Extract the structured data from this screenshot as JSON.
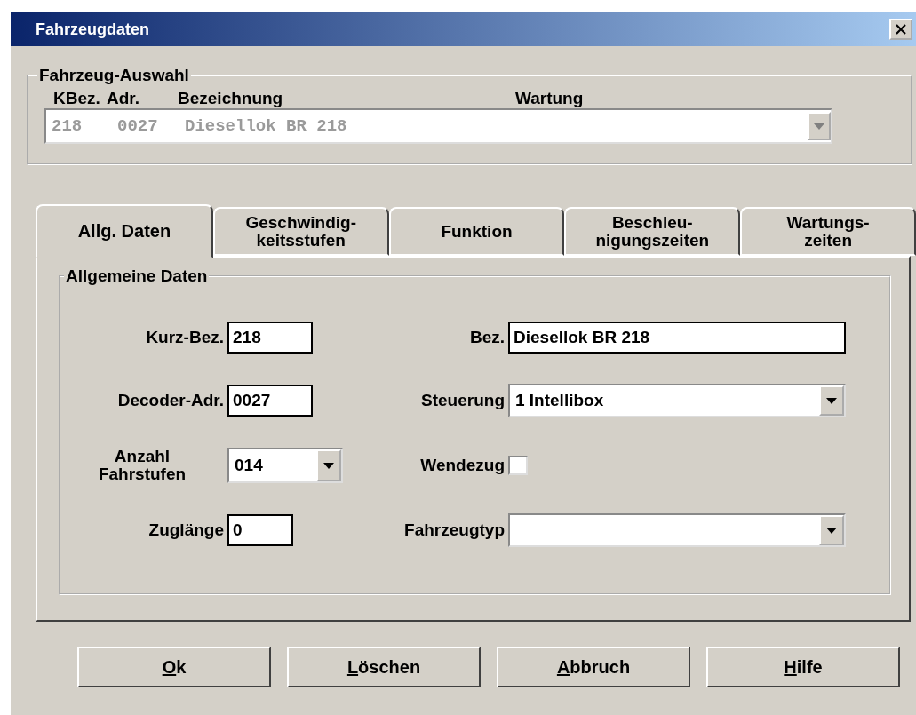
{
  "window": {
    "title": "Fahrzeugdaten"
  },
  "vehicle_selection": {
    "title": "Fahrzeug-Auswahl",
    "columns": [
      "KBez.",
      "Adr.",
      "Bezeichnung",
      "Wartung"
    ],
    "disabled": true,
    "value": [
      "218",
      "0027",
      "Diesellok BR 218"
    ]
  },
  "tabs": [
    {
      "label": "Allg. Daten",
      "selected": true
    },
    {
      "label": "Geschwindig-\nkeitsstufen",
      "selected": false
    },
    {
      "label": "Funktion",
      "selected": false
    },
    {
      "label": "Beschleu-\nnigungszeiten",
      "selected": false
    },
    {
      "label": "Wartungs-\nzeiten",
      "selected": false
    }
  ],
  "general": {
    "title": "Allgemeine Daten",
    "left": [
      {
        "kind": "text",
        "label": "Kurz-Bez.",
        "value": "218"
      },
      {
        "kind": "text",
        "label": "Decoder-Adr.",
        "value": "0027"
      },
      {
        "kind": "combo",
        "label": "Anzahl\nFahrstufen",
        "value": "014"
      },
      {
        "kind": "text",
        "label": "Zuglänge",
        "value": "0"
      }
    ],
    "right": [
      {
        "kind": "text",
        "label": "Bez.",
        "value": "Diesellok BR 218"
      },
      {
        "kind": "combo",
        "label": "Steuerung",
        "value": "1 Intellibox"
      },
      {
        "kind": "check",
        "label": "Wendezug",
        "checked": false
      },
      {
        "kind": "combo",
        "label": "Fahrzeugtyp"
      }
    ]
  },
  "buttons": [
    {
      "label": "Ok",
      "underline_first": true
    },
    {
      "label": "Löschen",
      "underline_first": true
    },
    {
      "label": "Abbruch",
      "underline_first": true
    },
    {
      "label": "Hilfe",
      "underline_first": true
    }
  ]
}
